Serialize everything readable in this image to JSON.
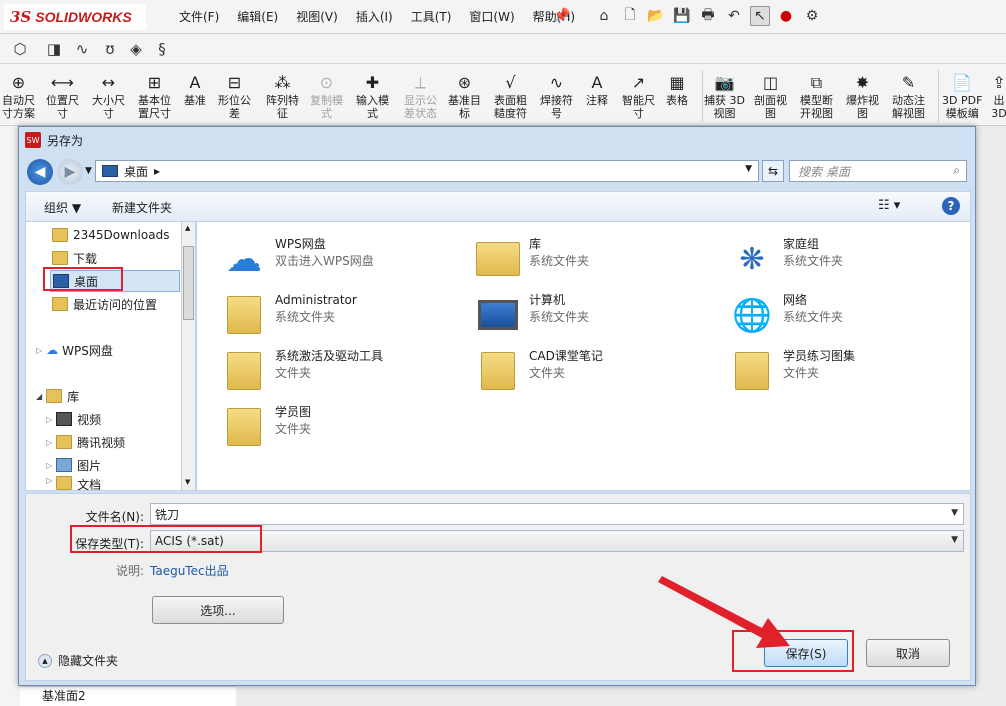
{
  "app": {
    "logo_prefix": "3S",
    "logo_text": "SOLIDWORKS",
    "menu": [
      "文件(F)",
      "编辑(E)",
      "视图(V)",
      "插入(I)",
      "工具(T)",
      "窗口(W)",
      "帮助(H)"
    ]
  },
  "toolbar": {
    "items": [
      {
        "label": "自动尺\n寸方案",
        "icon": "auto-dimension-icon",
        "enabled": true
      },
      {
        "label": "位置尺\n寸",
        "icon": "location-dimension-icon",
        "enabled": true
      },
      {
        "label": "大小尺\n寸",
        "icon": "size-dimension-icon",
        "enabled": true
      },
      {
        "label": "基本位\n置尺寸",
        "icon": "basic-location-dimension-icon",
        "enabled": true
      },
      {
        "label": "基准",
        "icon": "datum-icon",
        "enabled": true
      },
      {
        "label": "形位公\n差",
        "icon": "geometric-tolerance-icon",
        "enabled": true
      },
      {
        "label": "阵列特\n征",
        "icon": "pattern-feature-icon",
        "enabled": true
      },
      {
        "label": "复制模\n式",
        "icon": "copy-scheme-icon",
        "enabled": false
      },
      {
        "label": "输入模\n式",
        "icon": "input-scheme-icon",
        "enabled": true
      },
      {
        "label": "显示公\n差状态",
        "icon": "show-tolerance-status-icon",
        "enabled": false
      },
      {
        "label": "基准目\n标",
        "icon": "datum-target-icon",
        "enabled": true
      },
      {
        "label": "表面粗\n糙度符",
        "icon": "surface-finish-icon",
        "enabled": true
      },
      {
        "label": "焊接符\n号",
        "icon": "weld-symbol-icon",
        "enabled": true
      },
      {
        "label": "注释",
        "icon": "note-icon",
        "enabled": true
      },
      {
        "label": "智能尺\n寸",
        "icon": "smart-dimension-icon",
        "enabled": true
      },
      {
        "label": "表格",
        "icon": "table-icon",
        "enabled": true
      },
      {
        "label": "捕获 3D\n视图",
        "icon": "capture-3d-view-icon",
        "enabled": true
      },
      {
        "label": "剖面视\n图",
        "icon": "section-view-icon",
        "enabled": true
      },
      {
        "label": "模型断\n开视图",
        "icon": "model-break-view-icon",
        "enabled": true
      },
      {
        "label": "爆炸视\n图",
        "icon": "exploded-view-icon",
        "enabled": true
      },
      {
        "label": "动态注\n解视图",
        "icon": "dynamic-annotation-view-icon",
        "enabled": true
      },
      {
        "label": "3D PDF\n模板编",
        "icon": "3d-pdf-template-icon",
        "enabled": true
      },
      {
        "label": "出\n3D",
        "icon": "publish-3d-icon",
        "enabled": true
      }
    ]
  },
  "tree_bottom": "基准面2",
  "dialog": {
    "title": "另存为",
    "address": "桌面",
    "search_placeholder": "搜索 桌面",
    "commands": {
      "organize": "组织 ▼",
      "new_folder": "新建文件夹"
    },
    "nav_items": [
      {
        "label": "2345Downloads",
        "kind": "folder"
      },
      {
        "label": "下载",
        "kind": "download"
      },
      {
        "label": "桌面",
        "kind": "desktop",
        "selected": true
      },
      {
        "label": "最近访问的位置",
        "kind": "recent"
      },
      {
        "label": "WPS网盘",
        "kind": "cloud"
      },
      {
        "label": "库",
        "kind": "library"
      },
      {
        "label": "视频",
        "kind": "video"
      },
      {
        "label": "腾讯视频",
        "kind": "tencent"
      },
      {
        "label": "图片",
        "kind": "picture"
      },
      {
        "label": "文档",
        "kind": "document"
      }
    ],
    "files": [
      {
        "name": "WPS网盘",
        "type": "双击进入WPS网盘",
        "icon": "cloud-icon"
      },
      {
        "name": "库",
        "type": "系统文件夹",
        "icon": "library-icon"
      },
      {
        "name": "家庭组",
        "type": "系统文件夹",
        "icon": "homegroup-icon"
      },
      {
        "name": "Administrator",
        "type": "系统文件夹",
        "icon": "user-folder-icon"
      },
      {
        "name": "计算机",
        "type": "系统文件夹",
        "icon": "computer-icon"
      },
      {
        "name": "网络",
        "type": "系统文件夹",
        "icon": "network-icon"
      },
      {
        "name": "系统激活及驱动工具",
        "type": "文件夹",
        "icon": "folder-icon"
      },
      {
        "name": "CAD课堂笔记",
        "type": "文件夹",
        "icon": "folder-icon"
      },
      {
        "name": "学员练习图集",
        "type": "文件夹",
        "icon": "folder-icon"
      },
      {
        "name": "学员图",
        "type": "文件夹",
        "icon": "folder-icon"
      }
    ],
    "filename_label": "文件名(N):",
    "filename_value": "铣刀",
    "filetype_label": "保存类型(T):",
    "filetype_value": "ACIS (*.sat)",
    "description_label": "说明:",
    "description_value": "TaeguTec出品",
    "options_button": "选项...",
    "hide_folders": "隐藏文件夹",
    "save_button": "保存(S)",
    "cancel_button": "取消"
  },
  "colors": {
    "highlight_red": "#e0202a",
    "link_blue": "#1a5aa8",
    "dialog_frame": "#cfe0f3"
  }
}
